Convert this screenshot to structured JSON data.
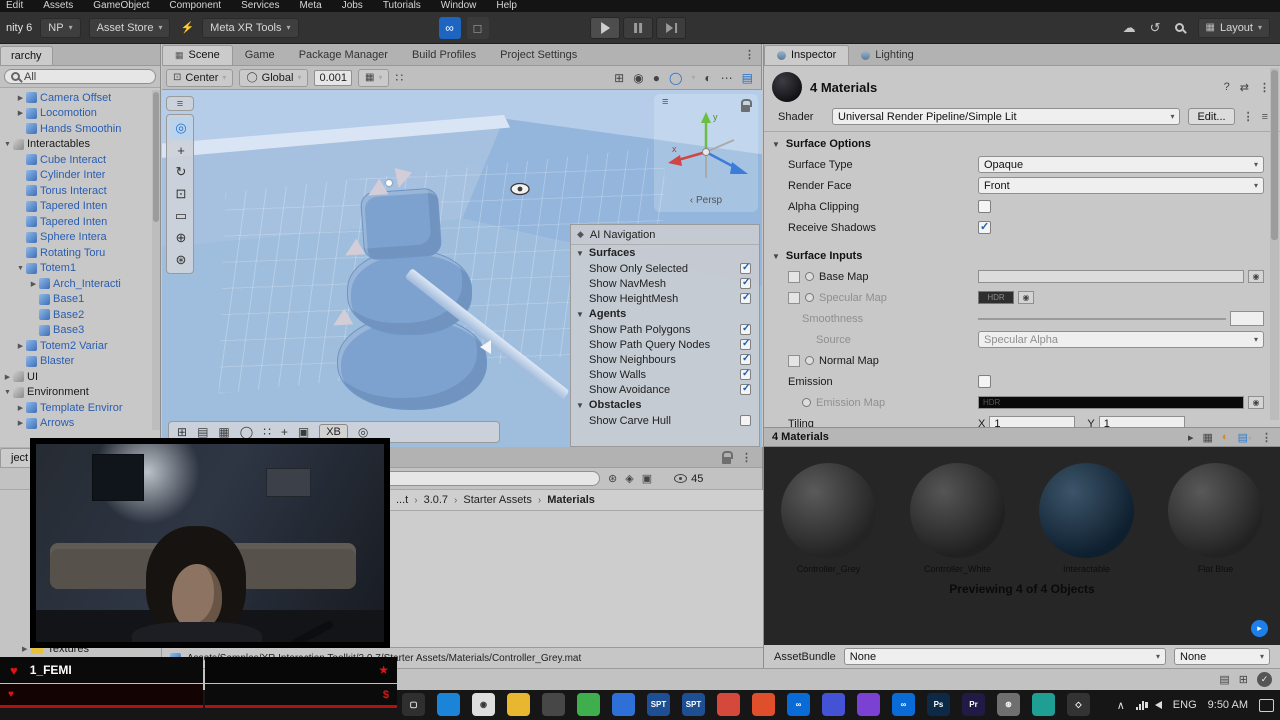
{
  "icons": {
    "hamburger": "≡",
    "dots": "⋮",
    "ellipsis": "⋯",
    "caret": "▾",
    "chevron": "›",
    "cloud": "☁",
    "history": "↺",
    "heart": "♥",
    "star": "★",
    "dollar": "$",
    "check": "✓",
    "arrow_down": "▼",
    "arrow_right": "▶",
    "infinity": "∞",
    "tray_chevron": "∧",
    "question": "?",
    "swap": "⇄",
    "grid": "▦",
    "play_small": "▸"
  },
  "menubar": {
    "items": [
      "Edit",
      "Assets",
      "GameObject",
      "Component",
      "Services",
      "Meta",
      "Jobs",
      "Tutorials",
      "Window",
      "Help"
    ]
  },
  "toolbar": {
    "version": "nity 6",
    "account": "NP",
    "asset_store": "Asset Store",
    "meta_xr": "Meta XR Tools",
    "layout": "Layout"
  },
  "hierarchy": {
    "tab_label": "rarchy",
    "search_text": "All",
    "items": [
      {
        "label": "Camera Offset",
        "color": "blue",
        "indent": 2,
        "arrow": "right",
        "chevron": false
      },
      {
        "label": "Locomotion",
        "color": "blue",
        "indent": 2,
        "arrow": "right",
        "chevron": false
      },
      {
        "label": "Hands Smoothin",
        "color": "blue",
        "indent": 2,
        "arrow": null,
        "chevron": false
      },
      {
        "label": "Interactables",
        "color": "black",
        "indent": 1,
        "arrow": "down",
        "chevron": false
      },
      {
        "label": "Cube Interact",
        "color": "blue",
        "indent": 2,
        "arrow": null,
        "chevron": true
      },
      {
        "label": "Cylinder Inter",
        "color": "blue",
        "indent": 2,
        "arrow": null,
        "chevron": true
      },
      {
        "label": "Torus Interact",
        "color": "blue",
        "indent": 2,
        "arrow": null,
        "chevron": true
      },
      {
        "label": "Tapered Inten",
        "color": "blue",
        "indent": 2,
        "arrow": null,
        "chevron": true
      },
      {
        "label": "Tapered Inten",
        "color": "blue",
        "indent": 2,
        "arrow": null,
        "chevron": true
      },
      {
        "label": "Sphere Intera",
        "color": "blue",
        "indent": 2,
        "arrow": null,
        "chevron": true
      },
      {
        "label": "Rotating Toru",
        "color": "blue",
        "indent": 2,
        "arrow": null,
        "chevron": true
      },
      {
        "label": "Totem1",
        "color": "blue",
        "indent": 2,
        "arrow": "down",
        "chevron": true
      },
      {
        "label": "Arch_Interacti",
        "color": "blue",
        "indent": 3,
        "arrow": "right",
        "chevron": false
      },
      {
        "label": "Base1",
        "color": "blue",
        "indent": 3,
        "arrow": null,
        "chevron": false
      },
      {
        "label": "Base2",
        "color": "blue",
        "indent": 3,
        "arrow": null,
        "chevron": false
      },
      {
        "label": "Base3",
        "color": "blue",
        "indent": 3,
        "arrow": null,
        "chevron": false
      },
      {
        "label": "Totem2 Variar",
        "color": "blue",
        "indent": 2,
        "arrow": "right",
        "chevron": true
      },
      {
        "label": "Blaster",
        "color": "blue",
        "indent": 2,
        "arrow": null,
        "chevron": true
      },
      {
        "label": "UI",
        "color": "black",
        "indent": 1,
        "arrow": "right",
        "chevron": false
      },
      {
        "label": "Environment",
        "color": "black",
        "indent": 1,
        "arrow": "down",
        "chevron": false
      },
      {
        "label": "Template Enviror",
        "color": "blue",
        "indent": 2,
        "arrow": "right",
        "chevron": true
      },
      {
        "label": "Arrows",
        "color": "blue",
        "indent": 2,
        "arrow": "right",
        "chevron": true
      }
    ]
  },
  "scene": {
    "tabs": [
      "Scene",
      "Game",
      "Package Manager",
      "Build Profiles",
      "Project Settings"
    ],
    "pivot": "Center",
    "orientation": "Global",
    "snap_value": "0.001",
    "persp_label": "Persp",
    "xb_label": "XB",
    "nav": {
      "title": "AI Navigation",
      "sections": [
        {
          "title": "Surfaces",
          "rows": [
            {
              "label": "Show Only Selected",
              "checked": true
            },
            {
              "label": "Show NavMesh",
              "checked": true
            },
            {
              "label": "Show HeightMesh",
              "checked": true
            }
          ]
        },
        {
          "title": "Agents",
          "rows": [
            {
              "label": "Show Path Polygons",
              "checked": true
            },
            {
              "label": "Show Path Query Nodes",
              "checked": true
            },
            {
              "label": "Show Neighbours",
              "checked": true
            },
            {
              "label": "Show Walls",
              "checked": true
            },
            {
              "label": "Show Avoidance",
              "checked": true
            }
          ]
        },
        {
          "title": "Obstacles",
          "rows": [
            {
              "label": "Show Carve Hull",
              "checked": false
            }
          ]
        }
      ]
    }
  },
  "project": {
    "tab_label": "ject",
    "count": "45",
    "breadcrumb": [
      "...t",
      "3.0.7",
      "Starter Assets",
      "Materials"
    ],
    "folder": "Textures",
    "footer_path": "Assets/Samples/XR Interaction Toolkit/3.0.7/Starter Assets/Materials/Controller_Grey.mat"
  },
  "inspector": {
    "tabs": [
      "Inspector",
      "Lighting"
    ],
    "title": "4 Materials",
    "shader_label": "Shader",
    "shader_value": "Universal Render Pipeline/Simple Lit",
    "edit_button": "Edit...",
    "surface_options": {
      "title": "Surface Options",
      "rows": [
        {
          "label": "Surface Type",
          "type": "dropdown",
          "value": "Opaque"
        },
        {
          "label": "Render Face",
          "type": "dropdown",
          "value": "Front"
        },
        {
          "label": "Alpha Clipping",
          "type": "checkbox",
          "checked": false
        },
        {
          "label": "Receive Shadows",
          "type": "checkbox",
          "checked": true
        }
      ]
    },
    "surface_inputs": {
      "title": "Surface Inputs",
      "base_map": "Base Map",
      "specular_map": "Specular Map",
      "smoothness": "Smoothness",
      "source_label": "Source",
      "source_value": "Specular Alpha",
      "normal_map": "Normal Map",
      "emission": "Emission",
      "emission_map": "Emission Map",
      "tiling_label": "Tiling",
      "x_label": "X",
      "x_value": "1",
      "y_label": "Y",
      "y_value": "1",
      "hdr": "HDR"
    },
    "preview": {
      "title": "4 Materials",
      "status": "Previewing 4 of 4 Objects",
      "materials": [
        {
          "name": "Controller_Grey",
          "color": "#3b3b3b"
        },
        {
          "name": "Controller_White",
          "color": "#353535"
        },
        {
          "name": "Interactable",
          "color": "#17344d"
        },
        {
          "name": "Flat Blue",
          "color": "#393939"
        }
      ]
    },
    "assetbundle": {
      "label": "AssetBundle",
      "value_a": "None",
      "value_b": "None"
    }
  },
  "stream": {
    "username": "1_FEMI"
  },
  "taskbar": {
    "lang": "ENG",
    "time": "9:50 AM",
    "icons": [
      {
        "name": "app-window",
        "color": "#2f2f2f",
        "glyph": "▢"
      },
      {
        "name": "app-edge-browser",
        "color": "#1b84d8",
        "glyph": ""
      },
      {
        "name": "app-recorder",
        "color": "#dedede",
        "glyph": "◉"
      },
      {
        "name": "app-file-explorer",
        "color": "#e9b62f",
        "glyph": ""
      },
      {
        "name": "app-editor",
        "color": "#474747",
        "glyph": ""
      },
      {
        "name": "app-green",
        "color": "#3fae4c",
        "glyph": ""
      },
      {
        "name": "app-blue-tool",
        "color": "#2f6fd8",
        "glyph": ""
      },
      {
        "name": "app-spt-1",
        "color": "#1f4f93",
        "glyph": "SPT"
      },
      {
        "name": "app-spt-2",
        "color": "#1f4f93",
        "glyph": "SPT"
      },
      {
        "name": "app-photos",
        "color": "#d4493b",
        "glyph": ""
      },
      {
        "name": "app-brave",
        "color": "#df4f2b",
        "glyph": ""
      },
      {
        "name": "app-meta-1",
        "color": "#0a6ad6",
        "glyph": "∞"
      },
      {
        "name": "app-chat",
        "color": "#4453d6",
        "glyph": ""
      },
      {
        "name": "app-purple",
        "color": "#7b41d2",
        "glyph": ""
      },
      {
        "name": "app-meta-2",
        "color": "#0a6ad6",
        "glyph": "∞"
      },
      {
        "name": "app-photoshop",
        "color": "#0c2a45",
        "glyph": "Ps"
      },
      {
        "name": "app-premiere",
        "color": "#201a45",
        "glyph": "Pr"
      },
      {
        "name": "app-settings",
        "color": "#6f6f6f",
        "glyph": "⊛"
      },
      {
        "name": "app-capture",
        "color": "#1f9f93",
        "glyph": ""
      },
      {
        "name": "app-dark",
        "color": "#333333",
        "glyph": "◇"
      }
    ]
  }
}
